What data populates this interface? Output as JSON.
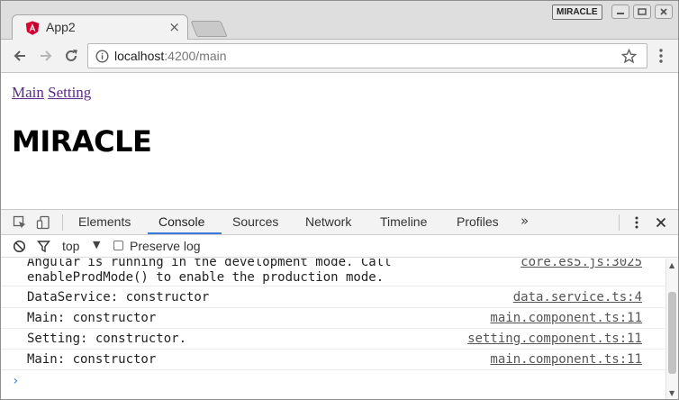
{
  "window": {
    "profile_label": "MIRACLE",
    "controls": [
      "minimize-icon",
      "restore-icon",
      "close-icon"
    ]
  },
  "tab": {
    "title": "App2",
    "favicon": "angular-logo-icon",
    "close_glyph": "×",
    "accent": "#dd0031"
  },
  "toolbar": {
    "url_host": "localhost",
    "url_path": ":4200/main",
    "icons": [
      "back-icon",
      "forward-icon",
      "reload-icon",
      "info-icon",
      "star-icon",
      "menu-icon"
    ]
  },
  "page": {
    "links": [
      "Main",
      "Setting"
    ],
    "heading": "MIRACLE",
    "link_color": "#5a2a8a"
  },
  "devtools": {
    "tabs": [
      "Elements",
      "Console",
      "Sources",
      "Network",
      "Timeline",
      "Profiles"
    ],
    "active_tab": "Console",
    "more_glyph": "»",
    "filter": {
      "context": "top",
      "preserve_log_label": "Preserve log",
      "preserve_log_checked": false
    },
    "messages": [
      {
        "text": "Angular is running in the development mode. Call\nenableProdMode() to enable the production mode.",
        "source": "core.es5.js:3025"
      },
      {
        "text": "DataService: constructor",
        "source": "data.service.ts:4"
      },
      {
        "text": "Main: constructor",
        "source": "main.component.ts:11"
      },
      {
        "text": "Setting: constructor.",
        "source": "setting.component.ts:11"
      },
      {
        "text": "Main: constructor",
        "source": "main.component.ts:11"
      }
    ],
    "prompt_glyph": "›",
    "accent": "#3879d9"
  }
}
